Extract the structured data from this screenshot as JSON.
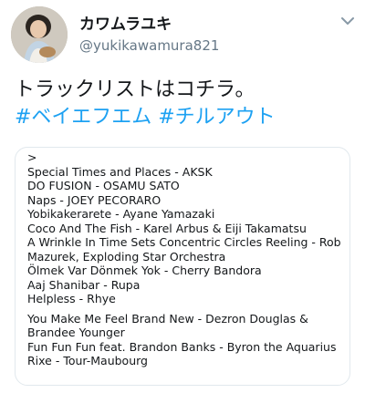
{
  "user": {
    "name": "カワムラユキ",
    "handle": "@yukikawamura821"
  },
  "tweet": {
    "text": "トラックリストはコチラ。",
    "hashtags": [
      "#ベイエフエム",
      "#チルアウト"
    ]
  },
  "tracklist": {
    "first": [
      ">",
      "Special Times and Places - AKSK",
      "DO FUSION - OSAMU SATO",
      "Naps - JOEY PECORARO",
      "Yobikakerarete - Ayane Yamazaki",
      "Coco And The Fish - Karel Arbus & Eiji Takamatsu",
      "A Wrinkle In Time Sets Concentric Circles Reeling - Rob Mazurek, Exploding Star Orchestra",
      "Ölmek Var Dönmek Yok - Cherry Bandora",
      "Aaj Shanibar - Rupa",
      "Helpless - Rhye"
    ],
    "second": [
      "You Make Me Feel Brand New - Dezron Douglas & Brandee Younger",
      "Fun Fun Fun feat. Brandon Banks - Byron the Aquarius",
      "Rixe - Tour-Maubourg"
    ]
  }
}
